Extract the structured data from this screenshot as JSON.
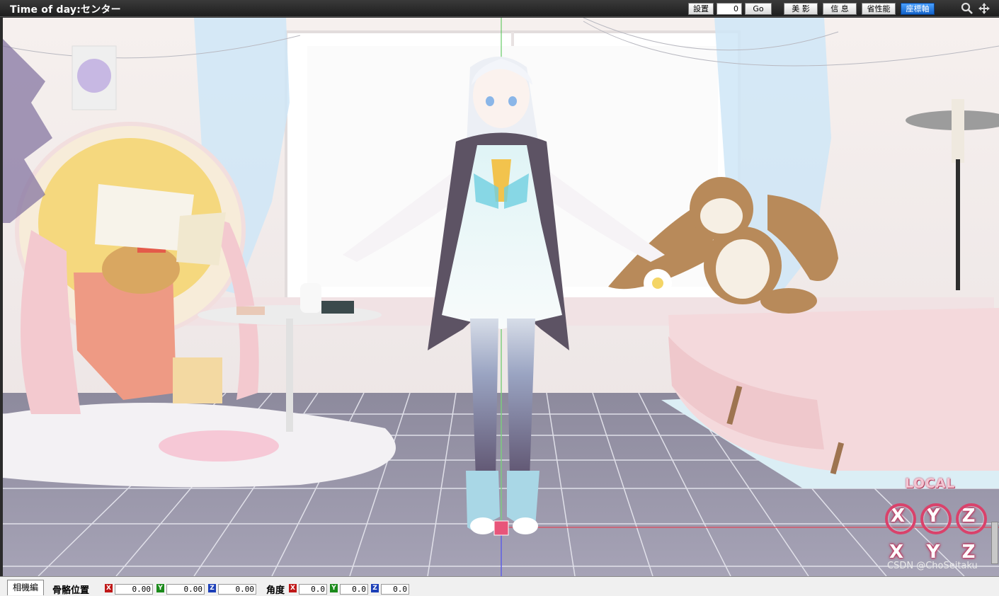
{
  "title": "Time of day:センター",
  "toolbar": {
    "settings_label": "設置",
    "frame_value": "0",
    "go_label": "Go",
    "shadow_label": "美 影",
    "info_label": "信 息",
    "perf_label": "省性能",
    "axis_label": "座標軸"
  },
  "viewport": {
    "local_label": "LOCAL",
    "rotate_buttons": [
      "X",
      "Y",
      "Z"
    ],
    "move_buttons": [
      "X",
      "Y",
      "Z"
    ],
    "watermark": "CSDN @ChoSeitaku"
  },
  "bottom": {
    "camera_tab": "相機編",
    "bone_position_label": "骨骼位置",
    "position": {
      "x": "0.00",
      "y": "0.00",
      "z": "0.00"
    },
    "angle_label": "角度",
    "angle": {
      "x": "0.0",
      "y": "0.0",
      "z": "0.0"
    },
    "axis_tags": {
      "x": "X",
      "y": "Y",
      "z": "Z"
    }
  },
  "colors": {
    "accent_active": "#1a73e8",
    "axis_x": "#c01818",
    "axis_y": "#1b8a1b",
    "axis_z": "#1c3fb8",
    "gizmo_pink": "#d9426b"
  }
}
